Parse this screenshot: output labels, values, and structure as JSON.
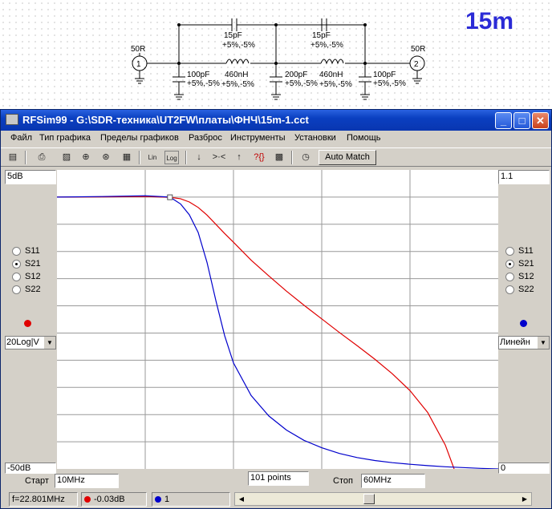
{
  "schematic": {
    "band_label": "15m",
    "port1": {
      "number": "1",
      "impedance": "50R"
    },
    "port2": {
      "number": "2",
      "impedance": "50R"
    },
    "series_cap1": {
      "value": "15pF",
      "tolerance": "+5%,-5%"
    },
    "series_cap2": {
      "value": "15pF",
      "tolerance": "+5%,-5%"
    },
    "inductor1": {
      "value": "460nH",
      "tolerance": "+5%,-5%"
    },
    "inductor2": {
      "value": "460nH",
      "tolerance": "+5%,-5%"
    },
    "shunt_cap1": {
      "value": "100pF",
      "tolerance": "+5%,-5%"
    },
    "shunt_cap2": {
      "value": "200pF",
      "tolerance": "+5%,-5%"
    },
    "shunt_cap3": {
      "value": "100pF",
      "tolerance": "+5%,-5%"
    }
  },
  "window": {
    "title": "RFSim99 - G:\\SDR-техника\\UT2FW\\платы\\ФНЧ\\15m-1.cct",
    "minimize": "_",
    "maximize": "□",
    "close": "✕"
  },
  "menu": [
    "Файл",
    "Тип графика",
    "Пределы графиков",
    "Разброс",
    "Инструменты",
    "Установки",
    "Помощь"
  ],
  "toolbar": {
    "icons": [
      "open-icon",
      "print-icon",
      "graph-icon",
      "smith-icon",
      "polar-icon",
      "table-icon",
      "lin-icon",
      "log-icon",
      "down-arrow-icon",
      "zoom-icon",
      "up-arrow-icon",
      "help-icon",
      "chip-icon",
      "stopwatch-icon"
    ],
    "lin_label": "Lin",
    "log_label": "Log",
    "zoom_label": ">·<",
    "help_label": "?{}",
    "auto_match": "Auto Match"
  },
  "left_panel": {
    "top_value": "5dB",
    "bottom_value": "-50dB",
    "radios": [
      "S11",
      "S21",
      "S12",
      "S22"
    ],
    "selected": "S21",
    "trace_color": "#e00000",
    "scale": "20Log|V"
  },
  "right_panel": {
    "top_value": "1.1",
    "bottom_value": "0",
    "radios": [
      "S11",
      "S21",
      "S12",
      "S22"
    ],
    "selected": "S21",
    "trace_color": "#0000cc",
    "scale": "Линейн"
  },
  "bottom": {
    "start_label": "Старт",
    "start_value": "10MHz",
    "points": "101 points",
    "stop_label": "Стоп",
    "stop_value": "60MHz"
  },
  "status": {
    "frequency": "f=22.801MHz",
    "red_value": "-0.03dB",
    "blue_value": "1"
  },
  "chart_data": {
    "type": "line",
    "x_range": [
      10,
      60
    ],
    "x_unit": "MHz",
    "grid": true,
    "series": [
      {
        "color": "#e00000",
        "axis": "left",
        "ylim": [
          -50,
          5
        ],
        "x": [
          10,
          15,
          20,
          22.8,
          24,
          25,
          26,
          27,
          28,
          29,
          30,
          32,
          34,
          36,
          38,
          40,
          42,
          44,
          46,
          48,
          50,
          52,
          54,
          55
        ],
        "y": [
          0,
          0.05,
          0.1,
          -0.03,
          -0.3,
          -0.9,
          -1.9,
          -3.3,
          -5.0,
          -6.7,
          -8.3,
          -11.6,
          -14.5,
          -17.3,
          -19.9,
          -22.4,
          -24.9,
          -27.3,
          -29.8,
          -32.5,
          -35.6,
          -39.6,
          -45.6,
          -50
        ]
      },
      {
        "color": "#0000cc",
        "axis": "right",
        "ylim": [
          0,
          1.1
        ],
        "x": [
          10,
          15,
          20,
          22.8,
          24,
          25,
          26,
          27,
          28,
          29,
          30,
          32,
          34,
          36,
          38,
          40,
          42,
          44,
          46,
          48,
          50,
          52,
          54,
          56,
          58,
          60
        ],
        "y": [
          1.0,
          1.002,
          1.005,
          1.0,
          0.975,
          0.935,
          0.87,
          0.76,
          0.62,
          0.49,
          0.39,
          0.27,
          0.195,
          0.143,
          0.105,
          0.078,
          0.057,
          0.042,
          0.031,
          0.023,
          0.017,
          0.012,
          0.008,
          0.005,
          0.002,
          0.0
        ]
      }
    ],
    "marker_x": 22.8
  }
}
